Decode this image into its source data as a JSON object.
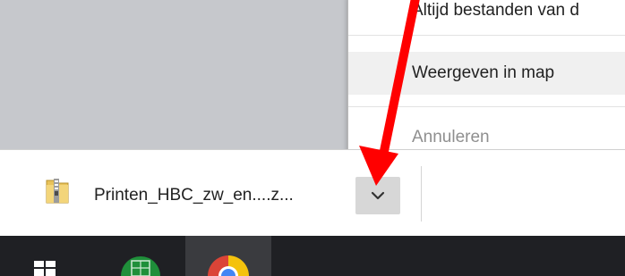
{
  "context_menu": {
    "items": [
      {
        "label": "Altijd bestanden van d",
        "state": "normal"
      },
      {
        "label": "Weergeven in map",
        "state": "hovered"
      },
      {
        "label": "Annuleren",
        "state": "disabled"
      }
    ]
  },
  "download_shelf": {
    "file_name": "Printen_HBC_zw_en....z...",
    "file_icon": "zip-folder-icon",
    "menu_button_icon": "chevron-down-icon"
  },
  "taskbar": {
    "icons": [
      "windows-start-icon",
      "spreadsheet-app-icon",
      "chrome-icon"
    ]
  },
  "annotation": {
    "type": "arrow",
    "color": "#ff0000"
  },
  "colors": {
    "content_gray": "#c6c8cc",
    "menu_hover": "#f0f0f0",
    "disabled_text": "#8f8f8f",
    "taskbar": "#1f2024",
    "chevron_button": "#d7d7d7"
  }
}
